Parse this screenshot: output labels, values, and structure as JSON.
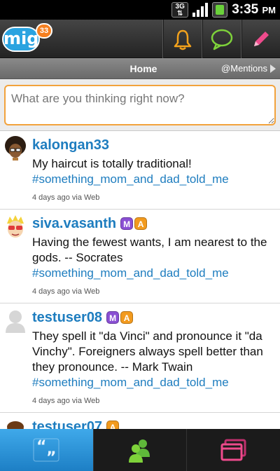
{
  "status_bar": {
    "network": "3G",
    "time": "3:35",
    "ampm": "PM"
  },
  "app": {
    "logo_text": "mig",
    "logo_badge": "33"
  },
  "toolbar": {
    "actions": [
      {
        "name": "notifications",
        "icon": "bell-icon",
        "color": "#f3a21c"
      },
      {
        "name": "chat",
        "icon": "chat-bubble-icon",
        "color": "#7ed23a"
      },
      {
        "name": "compose",
        "icon": "pencil-icon",
        "color": "#ee4b8c"
      }
    ]
  },
  "tabs": {
    "home": "Home",
    "mentions": "@Mentions"
  },
  "compose": {
    "placeholder": "What are you thinking right now?"
  },
  "posts": [
    {
      "username": "kalongan33",
      "badges": [],
      "text": "My haircut is totally traditional!",
      "tag": "#something_mom_and_dad_told_me",
      "meta": "4 days ago via Web"
    },
    {
      "username": "siva.vasanth",
      "badges": [
        "M",
        "A"
      ],
      "text": "Having the fewest wants, I am nearest to the gods. -- Socrates",
      "tag": "#something_mom_and_dad_told_me",
      "meta": "4 days ago via Web"
    },
    {
      "username": "testuser08",
      "badges": [
        "M",
        "A"
      ],
      "text": "They spell it \"da Vinci\" and pronounce it \"da Vinchy\". Foreigners always spell better than they pronounce. -- Mark Twain",
      "tag": "#something_mom_and_dad_told_me",
      "meta": "4 days ago via Web"
    },
    {
      "username": "testuser07",
      "badges": [
        "A"
      ],
      "text": "",
      "tag": "",
      "meta": ""
    }
  ],
  "bottom_nav": [
    {
      "name": "feed",
      "icon": "quote-icon",
      "active": true
    },
    {
      "name": "people",
      "icon": "people-icon",
      "active": false
    },
    {
      "name": "windows",
      "icon": "windows-icon",
      "active": false
    }
  ],
  "colors": {
    "accent_blue": "#1e7dbf",
    "compose_border": "#f2a23c",
    "badge_m": "#8a4fd3",
    "badge_a": "#f29a1e"
  }
}
